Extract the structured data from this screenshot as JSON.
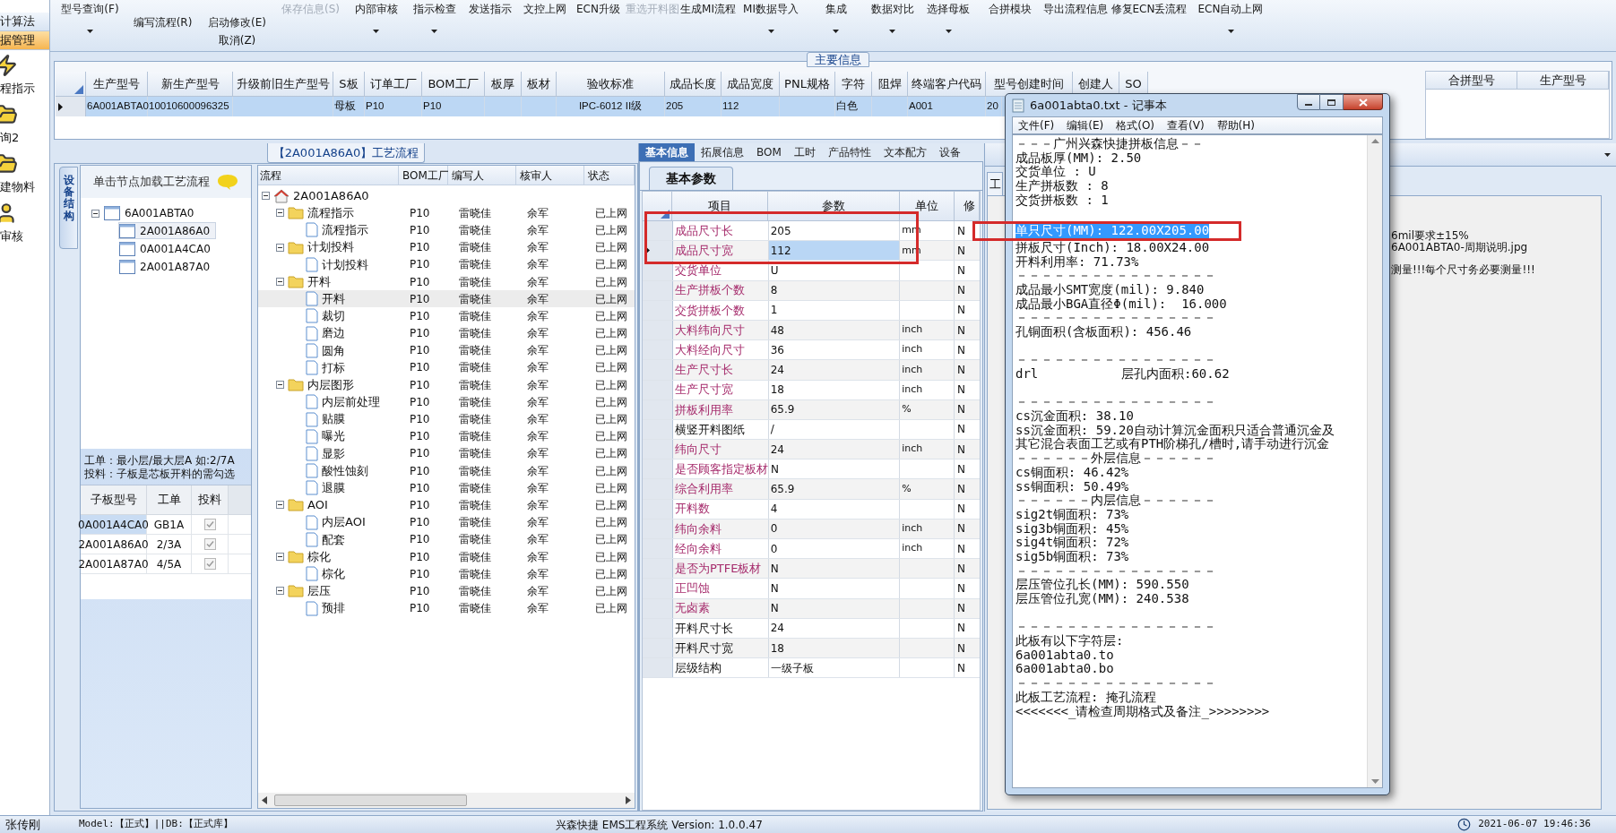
{
  "sidebar": {
    "items": [
      {
        "label": "计算法",
        "kind": "bar",
        "selected": false
      },
      {
        "label": "据管理",
        "kind": "bar",
        "selected": true
      },
      {
        "label": "程指示",
        "kind": "tool",
        "selected": false
      },
      {
        "label": "询2",
        "kind": "tool",
        "selected": false
      },
      {
        "label": "建物料",
        "kind": "tool",
        "selected": false
      },
      {
        "label": "审核",
        "kind": "tool",
        "selected": false
      }
    ]
  },
  "toolbar": [
    {
      "label": "型号查询(F)",
      "kind": "top",
      "disabled": false,
      "dropdown": true
    },
    {
      "label": "编写流程(R)",
      "kind": "low",
      "disabled": false,
      "dropdown": false
    },
    {
      "label": "启动修改(E)",
      "kind": "low",
      "disabled": false,
      "dropdown": false,
      "sub": "取消(Z)"
    },
    {
      "label": "保存信息(S)",
      "kind": "top",
      "disabled": true,
      "dropdown": false
    },
    {
      "label": "内部审核",
      "kind": "top",
      "disabled": false,
      "dropdown": true
    },
    {
      "label": "指示检查",
      "kind": "top",
      "disabled": false,
      "dropdown": true
    },
    {
      "label": "发送指示",
      "kind": "top",
      "disabled": false,
      "dropdown": false
    },
    {
      "label": "文控上网",
      "kind": "top",
      "disabled": false,
      "dropdown": false
    },
    {
      "label": "ECN升级",
      "kind": "top",
      "disabled": false,
      "dropdown": false
    },
    {
      "label": "重选开料图",
      "kind": "top",
      "disabled": true,
      "dropdown": false
    },
    {
      "label": "生成MI流程",
      "kind": "top",
      "disabled": false,
      "dropdown": false
    },
    {
      "label": "MI数据导入",
      "kind": "top",
      "disabled": false,
      "dropdown": true
    },
    {
      "label": "集成",
      "kind": "top",
      "disabled": false,
      "dropdown": true
    },
    {
      "label": "数据对比",
      "kind": "top",
      "disabled": false,
      "dropdown": true
    },
    {
      "label": "选择母板",
      "kind": "top",
      "disabled": false,
      "dropdown": true
    },
    {
      "label": "合拼模块",
      "kind": "top",
      "disabled": false,
      "dropdown": false
    },
    {
      "label": "导出流程信息",
      "kind": "top",
      "disabled": false,
      "dropdown": false
    },
    {
      "label": "修复ECN丢流程",
      "kind": "top",
      "disabled": false,
      "dropdown": false
    },
    {
      "label": "ECN自动上网",
      "kind": "top",
      "disabled": false,
      "dropdown": true
    }
  ],
  "main_info": {
    "title": "主要信息",
    "columns": [
      "生产型号",
      "新生产型号",
      "升级前旧生产型号",
      "S板",
      "订单工厂",
      "BOM工厂",
      "板厚",
      "板材",
      "验收标准",
      "成品长度",
      "成品宽度",
      "PNL规格",
      "字符",
      "阻焊",
      "终端客户代码",
      "型号创建时间",
      "创建人",
      "SO"
    ],
    "row": {
      "selected": true,
      "cells": [
        "6A001ABTA0",
        "10010600096325",
        null,
        "母板",
        "P10",
        "P10",
        null,
        null,
        "IPC-6012 II级",
        "205",
        "112",
        null,
        "白色",
        null,
        "A001",
        "20",
        null,
        null
      ]
    },
    "merge_columns": [
      "合拼型号",
      "生产型号"
    ]
  },
  "process_panel": {
    "title": "【2A001A86A0】工艺流程",
    "side_tab": "设备结构",
    "tree_hint": "单击节点加载工艺流程",
    "tree": [
      {
        "label": "6A001ABTA0",
        "expanded": true,
        "selected": false,
        "children": [
          {
            "label": "2A001A86A0",
            "selected": true
          },
          {
            "label": "0A001A4CA0",
            "selected": false
          },
          {
            "label": "2A001A87A0",
            "selected": false
          }
        ]
      }
    ],
    "notes": [
      "工单：最小层/最大层A 如:2/7A",
      "投料：子板是芯板开料的需勾选"
    ],
    "sub_boards": {
      "columns": [
        "子板型号",
        "工单",
        "投料"
      ],
      "rows": [
        {
          "board": "0A001A4CA0",
          "order": "GB1A",
          "checked": true,
          "selected": true
        },
        {
          "board": "2A001A86A0",
          "order": "2/3A",
          "checked": true,
          "selected": false
        },
        {
          "board": "2A001A87A0",
          "order": "4/5A",
          "checked": true,
          "selected": false
        }
      ]
    },
    "flow": {
      "columns": [
        "流程",
        "BOM工厂",
        "编写人",
        "核审人",
        "状态"
      ],
      "root": {
        "label": "2A001A86A0",
        "kind": "root",
        "expanded": true,
        "selected": false,
        "children": [
          {
            "label": "流程指示",
            "kind": "folder",
            "expanded": true,
            "selected": false,
            "bom": "P10",
            "writer": "雷晓佳",
            "reviewer": "余军",
            "status": "已上网",
            "children": [
              {
                "label": "流程指示",
                "kind": "step",
                "selected": false,
                "bom": "P10",
                "writer": "雷晓佳",
                "reviewer": "余军",
                "status": "已上网"
              }
            ]
          },
          {
            "label": "计划投料",
            "kind": "folder",
            "expanded": true,
            "selected": false,
            "bom": "P10",
            "writer": "雷晓佳",
            "reviewer": "余军",
            "status": "已上网",
            "children": [
              {
                "label": "计划投料",
                "kind": "step",
                "selected": false,
                "bom": "P10",
                "writer": "雷晓佳",
                "reviewer": "余军",
                "status": "已上网"
              }
            ]
          },
          {
            "label": "开料",
            "kind": "folder",
            "expanded": true,
            "selected": false,
            "bom": "P10",
            "writer": "雷晓佳",
            "reviewer": "余军",
            "status": "已上网",
            "children": [
              {
                "label": "开料",
                "kind": "step",
                "selected": true,
                "bom": "P10",
                "writer": "雷晓佳",
                "reviewer": "余军",
                "status": "已上网"
              },
              {
                "label": "裁切",
                "kind": "step",
                "selected": false,
                "bom": "P10",
                "writer": "雷晓佳",
                "reviewer": "余军",
                "status": "已上网"
              },
              {
                "label": "磨边",
                "kind": "step",
                "selected": false,
                "bom": "P10",
                "writer": "雷晓佳",
                "reviewer": "余军",
                "status": "已上网"
              },
              {
                "label": "圆角",
                "kind": "step",
                "selected": false,
                "bom": "P10",
                "writer": "雷晓佳",
                "reviewer": "余军",
                "status": "已上网"
              },
              {
                "label": "打标",
                "kind": "step",
                "selected": false,
                "bom": "P10",
                "writer": "雷晓佳",
                "reviewer": "余军",
                "status": "已上网"
              }
            ]
          },
          {
            "label": "内层图形",
            "kind": "folder",
            "expanded": true,
            "selected": false,
            "bom": "P10",
            "writer": "雷晓佳",
            "reviewer": "余军",
            "status": "已上网",
            "children": [
              {
                "label": "内层前处理",
                "kind": "step",
                "selected": false,
                "bom": "P10",
                "writer": "雷晓佳",
                "reviewer": "余军",
                "status": "已上网"
              },
              {
                "label": "贴膜",
                "kind": "step",
                "selected": false,
                "bom": "P10",
                "writer": "雷晓佳",
                "reviewer": "余军",
                "status": "已上网"
              },
              {
                "label": "曝光",
                "kind": "step",
                "selected": false,
                "bom": "P10",
                "writer": "雷晓佳",
                "reviewer": "余军",
                "status": "已上网"
              },
              {
                "label": "显影",
                "kind": "step",
                "selected": false,
                "bom": "P10",
                "writer": "雷晓佳",
                "reviewer": "余军",
                "status": "已上网"
              },
              {
                "label": "酸性蚀刻",
                "kind": "step",
                "selected": false,
                "bom": "P10",
                "writer": "雷晓佳",
                "reviewer": "余军",
                "status": "已上网"
              },
              {
                "label": "退膜",
                "kind": "step",
                "selected": false,
                "bom": "P10",
                "writer": "雷晓佳",
                "reviewer": "余军",
                "status": "已上网"
              }
            ]
          },
          {
            "label": "AOI",
            "kind": "folder",
            "expanded": true,
            "selected": false,
            "bom": "P10",
            "writer": "雷晓佳",
            "reviewer": "余军",
            "status": "已上网",
            "children": [
              {
                "label": "内层AOI",
                "kind": "step",
                "selected": false,
                "bom": "P10",
                "writer": "雷晓佳",
                "reviewer": "余军",
                "status": "已上网"
              },
              {
                "label": "配套",
                "kind": "step",
                "selected": false,
                "bom": "P10",
                "writer": "雷晓佳",
                "reviewer": "余军",
                "status": "已上网"
              }
            ]
          },
          {
            "label": "棕化",
            "kind": "folder",
            "expanded": true,
            "selected": false,
            "bom": "P10",
            "writer": "雷晓佳",
            "reviewer": "余军",
            "status": "已上网",
            "children": [
              {
                "label": "棕化",
                "kind": "step",
                "selected": false,
                "bom": "P10",
                "writer": "雷晓佳",
                "reviewer": "余军",
                "status": "已上网"
              }
            ]
          },
          {
            "label": "层压",
            "kind": "folder",
            "expanded": true,
            "selected": false,
            "bom": "P10",
            "writer": "雷晓佳",
            "reviewer": "余军",
            "status": "已上网",
            "children": [
              {
                "label": "预排",
                "kind": "step",
                "selected": false,
                "bom": "P10",
                "writer": "雷晓佳",
                "reviewer": "余军",
                "status": "已上网"
              }
            ]
          }
        ]
      }
    }
  },
  "params_panel": {
    "tabs": [
      {
        "label": "基本信息",
        "selected": true
      },
      {
        "label": "拓展信息",
        "selected": false
      },
      {
        "label": "BOM",
        "selected": false
      },
      {
        "label": "工时",
        "selected": false
      },
      {
        "label": "产品特性",
        "selected": false
      },
      {
        "label": "文本配方",
        "selected": false
      },
      {
        "label": "设备",
        "selected": false
      }
    ],
    "subtab": "基本参数",
    "columns": [
      "项目",
      "参数",
      "单位",
      "修"
    ],
    "rows": [
      {
        "item": "成品尺寸长",
        "value": "205",
        "unit": "mm",
        "flag": "N",
        "emphasized": true,
        "selected": false,
        "boxed": true
      },
      {
        "item": "成品尺寸宽",
        "value": "112",
        "unit": "mm",
        "flag": "N",
        "emphasized": true,
        "selected": true,
        "boxed": true
      },
      {
        "item": "交货单位",
        "value": "U",
        "flag": "N",
        "emphasized": true,
        "selected": false,
        "boxed": false
      },
      {
        "item": "生产拼板个数",
        "value": "8",
        "flag": "N",
        "emphasized": true,
        "selected": false,
        "boxed": false
      },
      {
        "item": "交货拼板个数",
        "value": "1",
        "flag": "N",
        "emphasized": true,
        "selected": false,
        "boxed": false
      },
      {
        "item": "大料纬向尺寸",
        "value": "48",
        "unit": "inch",
        "flag": "N",
        "emphasized": true,
        "selected": false,
        "boxed": false
      },
      {
        "item": "大料经向尺寸",
        "value": "36",
        "unit": "inch",
        "flag": "N",
        "emphasized": true,
        "selected": false,
        "boxed": false
      },
      {
        "item": "生产尺寸长",
        "value": "24",
        "unit": "inch",
        "flag": "N",
        "emphasized": true,
        "selected": false,
        "boxed": false
      },
      {
        "item": "生产尺寸宽",
        "value": "18",
        "unit": "inch",
        "flag": "N",
        "emphasized": true,
        "selected": false,
        "boxed": false
      },
      {
        "item": "拼板利用率",
        "value": "65.9",
        "unit": "%",
        "flag": "N",
        "emphasized": true,
        "selected": false,
        "boxed": false
      },
      {
        "item": "横竖开料图纸",
        "value": "/",
        "flag": "N",
        "emphasized": false,
        "selected": false,
        "boxed": false
      },
      {
        "item": "纬向尺寸",
        "value": "24",
        "unit": "inch",
        "flag": "N",
        "emphasized": true,
        "selected": false,
        "boxed": false
      },
      {
        "item": "是否顾客指定板材",
        "value": "N",
        "flag": "N",
        "emphasized": true,
        "selected": false,
        "boxed": false
      },
      {
        "item": "综合利用率",
        "value": "65.9",
        "unit": "%",
        "flag": "N",
        "emphasized": true,
        "selected": false,
        "boxed": false
      },
      {
        "item": "开料数",
        "value": "4",
        "flag": "N",
        "emphasized": true,
        "selected": false,
        "boxed": false
      },
      {
        "item": "纬向余料",
        "value": "0",
        "unit": "inch",
        "flag": "N",
        "emphasized": true,
        "selected": false,
        "boxed": false
      },
      {
        "item": "经向余料",
        "value": "0",
        "unit": "inch",
        "flag": "N",
        "emphasized": true,
        "selected": false,
        "boxed": false
      },
      {
        "item": "是否为PTFE板材",
        "value": "N",
        "flag": "N",
        "emphasized": true,
        "selected": false,
        "boxed": false
      },
      {
        "item": "正凹蚀",
        "value": "N",
        "flag": "N",
        "emphasized": true,
        "selected": false,
        "boxed": false
      },
      {
        "item": "无卤素",
        "value": "N",
        "flag": "N",
        "emphasized": true,
        "selected": false,
        "boxed": false
      },
      {
        "item": "开料尺寸长",
        "value": "24",
        "flag": "N",
        "emphasized": false,
        "selected": false,
        "boxed": false
      },
      {
        "item": "开料尺寸宽",
        "value": "18",
        "flag": "N",
        "emphasized": false,
        "selected": false,
        "boxed": false
      },
      {
        "item": "层级结构",
        "value": "一级子板",
        "flag": "N",
        "emphasized": false,
        "selected": false,
        "boxed": false
      }
    ]
  },
  "right_panel": {
    "tab": "工",
    "lines": [
      {
        "kind": "text",
        "text": "6mil要求±15%"
      },
      {
        "kind": "text",
        "text": "6A001ABTA0-周期说明.jpg"
      },
      {
        "kind": "blank"
      },
      {
        "kind": "text",
        "text": "测量!!!每个尺寸务必要测量!!!"
      }
    ]
  },
  "notepad": {
    "title": "6a001abta0.txt - 记事本",
    "menu": [
      "文件(F)",
      "编辑(E)",
      "格式(O)",
      "查看(V)",
      "帮助(H)"
    ],
    "lines": [
      {
        "kind": "text",
        "text": "－－－广州兴森快捷拼板信息－－"
      },
      {
        "kind": "text",
        "text": "成品板厚(MM): 2.50"
      },
      {
        "kind": "text",
        "text": "交货单位 : U"
      },
      {
        "kind": "text",
        "text": "生产拼板数 : 8"
      },
      {
        "kind": "text",
        "text": "交货拼板数 : 1"
      },
      {
        "kind": "blank"
      },
      {
        "kind": "text",
        "text": "单只尺寸(MM): 122.00X205.00",
        "selected": true,
        "boxed": true
      },
      {
        "kind": "text",
        "text": "拼板尺寸(Inch): 18.00X24.00"
      },
      {
        "kind": "text",
        "text": "开料利用率: 71.73%"
      },
      {
        "kind": "text",
        "text": "－－－－－－－－－－－－－－－－"
      },
      {
        "kind": "text",
        "text": "成品最小SMT宽度(mil): 9.840"
      },
      {
        "kind": "text",
        "text": "成品最小BGA直径Φ(mil):  16.000"
      },
      {
        "kind": "text",
        "text": "－－－－－－－－－－－－－－－－"
      },
      {
        "kind": "text",
        "text": "孔铜面积(含板面积): 456.46"
      },
      {
        "kind": "blank"
      },
      {
        "kind": "text",
        "text": "－－－－－－－－－－－－－－－－"
      },
      {
        "kind": "text",
        "text": "drl           层孔内面积:60.62"
      },
      {
        "kind": "blank"
      },
      {
        "kind": "text",
        "text": "－－－－－－－－－－－－－－－－"
      },
      {
        "kind": "text",
        "text": "cs沉金面积: 38.10"
      },
      {
        "kind": "text",
        "text": "ss沉金面积: 59.20自动计算沉金面积只适合普通沉金及"
      },
      {
        "kind": "text",
        "text": "其它混合表面工艺或有PTH阶梯孔/槽时,请手动进行沉金"
      },
      {
        "kind": "text",
        "text": "－－－－－－外层信息－－－－－－"
      },
      {
        "kind": "text",
        "text": "cs铜面积: 46.42%"
      },
      {
        "kind": "text",
        "text": "ss铜面积: 50.49%"
      },
      {
        "kind": "text",
        "text": "－－－－－－内层信息－－－－－－"
      },
      {
        "kind": "text",
        "text": "sig2t铜面积: 73%"
      },
      {
        "kind": "text",
        "text": "sig3b铜面积: 45%"
      },
      {
        "kind": "text",
        "text": "sig4t铜面积: 72%"
      },
      {
        "kind": "text",
        "text": "sig5b铜面积: 73%"
      },
      {
        "kind": "text",
        "text": "－－－－－－－－－－－－－－－－"
      },
      {
        "kind": "text",
        "text": "层压管位孔长(MM): 590.550"
      },
      {
        "kind": "text",
        "text": "层压管位孔宽(MM): 240.538"
      },
      {
        "kind": "blank"
      },
      {
        "kind": "text",
        "text": "－－－－－－－－－－－－－－－－"
      },
      {
        "kind": "text",
        "text": "此板有以下字符层:"
      },
      {
        "kind": "text",
        "text": "6a001abta0.to"
      },
      {
        "kind": "text",
        "text": "6a001abta0.bo"
      },
      {
        "kind": "text",
        "text": "－－－－－－－－－－－－－－－－"
      },
      {
        "kind": "text",
        "text": "此板工艺流程: 掩孔流程"
      },
      {
        "kind": "text",
        "text": "<<<<<<<_请检查周期格式及备注_>>>>>>>>"
      }
    ]
  },
  "status_bar": {
    "user": "张传刚",
    "db": "Model:【正式】||DB:【正式库】",
    "app": "兴森快捷 EMS工程系统 Version: 1.0.0.47",
    "time": "2021-06-07 19:46:36"
  }
}
